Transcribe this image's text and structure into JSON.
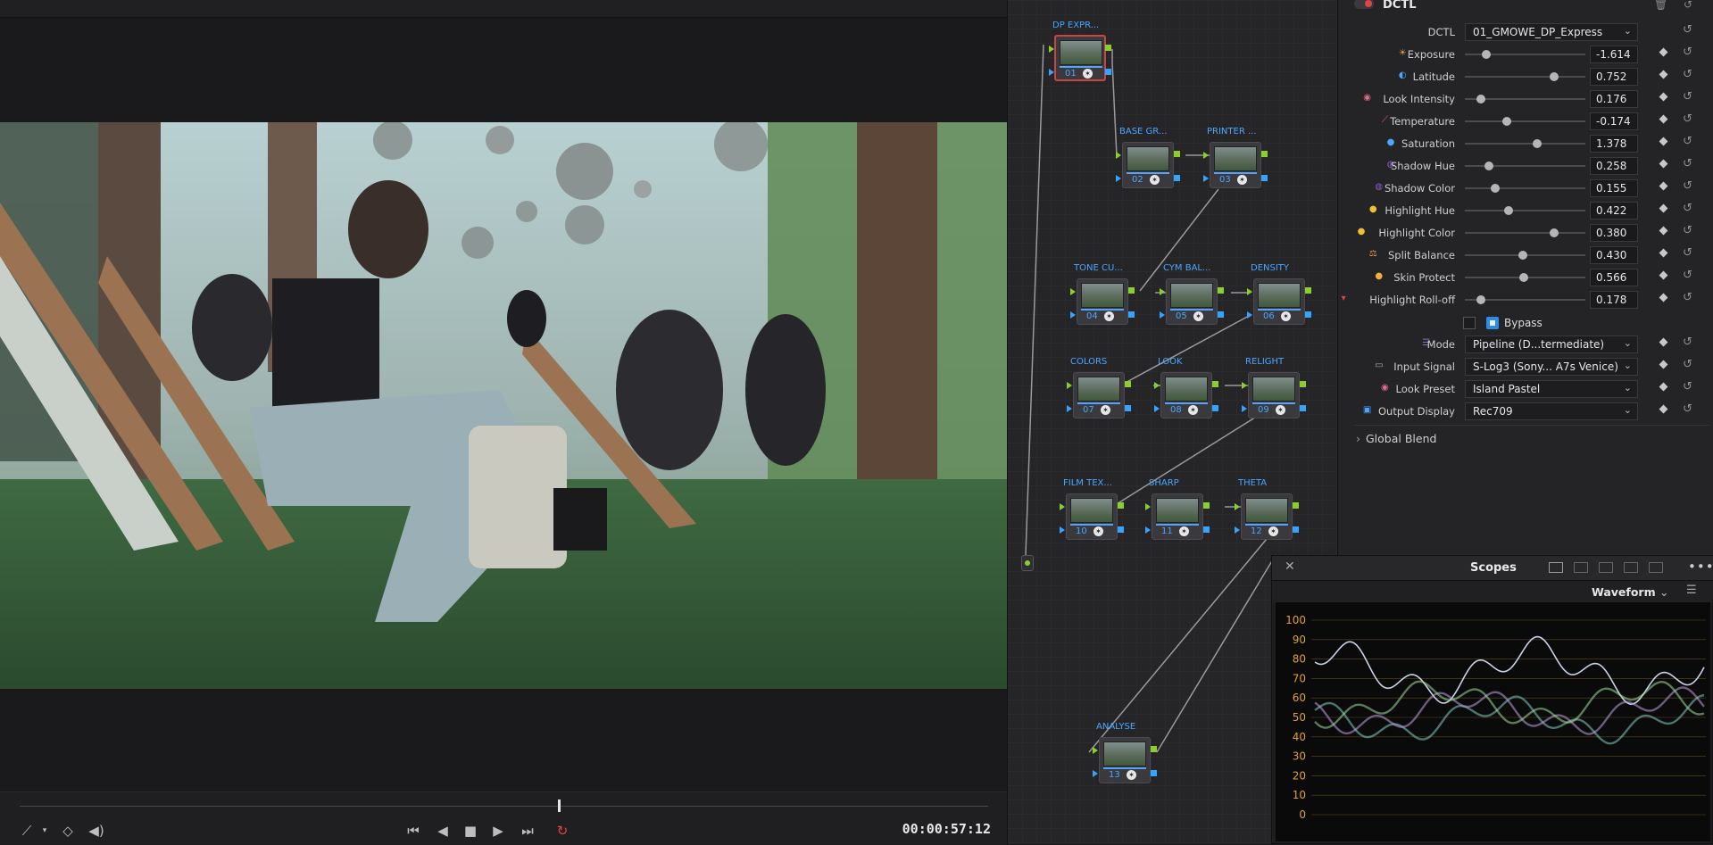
{
  "viewer": {
    "timecode": "00:00:57:12"
  },
  "nodes": [
    {
      "id": "01",
      "label": "DP EXPR..."
    },
    {
      "id": "02",
      "label": "BASE GR..."
    },
    {
      "id": "03",
      "label": "PRINTER ..."
    },
    {
      "id": "04",
      "label": "TONE CU..."
    },
    {
      "id": "05",
      "label": "CYM BAL..."
    },
    {
      "id": "06",
      "label": "DENSITY"
    },
    {
      "id": "07",
      "label": "COLORS"
    },
    {
      "id": "08",
      "label": "LOOK"
    },
    {
      "id": "09",
      "label": "RELIGHT"
    },
    {
      "id": "10",
      "label": "FILM TEX..."
    },
    {
      "id": "11",
      "label": "SHARP"
    },
    {
      "id": "12",
      "label": "THETA"
    },
    {
      "id": "13",
      "label": "ANALYSE"
    }
  ],
  "inspector": {
    "title": "DCTL",
    "dctl_label": "DCTL",
    "dctl_value": "01_GMOWE_DP_Express",
    "params": [
      {
        "label": "Exposure",
        "value": "-1.614",
        "pos": 0.18,
        "icon": "☀",
        "color": "#e0a040"
      },
      {
        "label": "Latitude",
        "value": "0.752",
        "pos": 0.74,
        "icon": "◐",
        "color": "#4aa6ff"
      },
      {
        "label": "Look Intensity",
        "value": "0.176",
        "pos": 0.13,
        "icon": "◉",
        "color": "#e06a8a"
      },
      {
        "label": "Temperature",
        "value": "-0.174",
        "pos": 0.35,
        "icon": "⟋",
        "color": "#e06a6a"
      },
      {
        "label": "Saturation",
        "value": "1.378",
        "pos": 0.6,
        "icon": "●",
        "color": "#4aa6ff"
      },
      {
        "label": "Shadow Hue",
        "value": "0.258",
        "pos": 0.2,
        "icon": "◍",
        "color": "#8a5ad0"
      },
      {
        "label": "Shadow Color",
        "value": "0.155",
        "pos": 0.25,
        "icon": "◍",
        "color": "#8a5ad0"
      },
      {
        "label": "Highlight Hue",
        "value": "0.422",
        "pos": 0.36,
        "icon": "●",
        "color": "#f0c030"
      },
      {
        "label": "Highlight Color",
        "value": "0.380",
        "pos": 0.74,
        "icon": "●",
        "color": "#f0c030"
      },
      {
        "label": "Split Balance",
        "value": "0.430",
        "pos": 0.48,
        "icon": "⚖",
        "color": "#e0a040"
      },
      {
        "label": "Skin Protect",
        "value": "0.566",
        "pos": 0.49,
        "icon": "●",
        "color": "#f0b040"
      },
      {
        "label": "Highlight Roll-off",
        "value": "0.178",
        "pos": 0.13,
        "icon": "▾",
        "color": "#e04444"
      }
    ],
    "bypass_label": "Bypass",
    "selects": [
      {
        "label": "Mode",
        "value": "Pipeline (D...termediate)",
        "icon": "☰",
        "color": "#8a6ad0"
      },
      {
        "label": "Input Signal",
        "value": "S-Log3 (Sony... A7s Venice)",
        "icon": "▭",
        "color": "#aaaaaa"
      },
      {
        "label": "Look Preset",
        "value": "Island Pastel",
        "icon": "◉",
        "color": "#e06a8a"
      },
      {
        "label": "Output Display",
        "value": "Rec709",
        "icon": "▣",
        "color": "#4aa6ff"
      }
    ],
    "global_blend": "Global Blend"
  },
  "scopes": {
    "title": "Scopes",
    "mode": "Waveform",
    "scale": [
      "100",
      "90",
      "80",
      "70",
      "60",
      "50",
      "40",
      "30",
      "20",
      "10",
      "0"
    ]
  },
  "colors": {
    "accent": "#4aa6ff",
    "node_green": "#8ccf2a",
    "selected_node": "#c94444"
  }
}
